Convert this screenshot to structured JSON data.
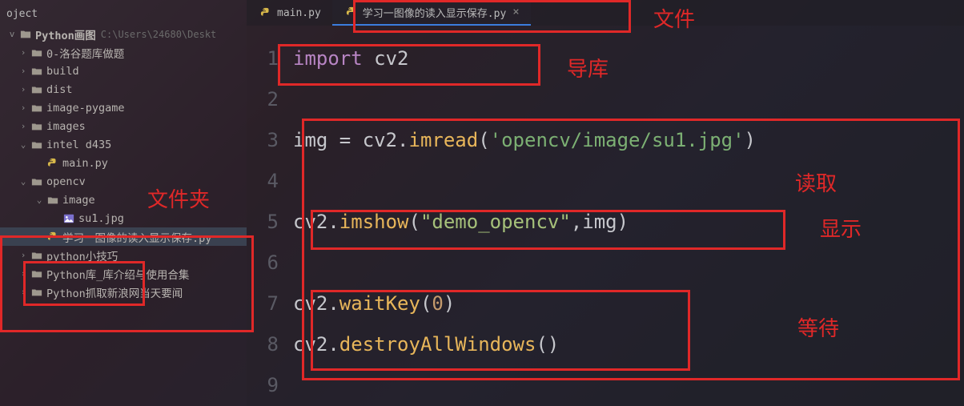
{
  "project": {
    "header": "oject",
    "rootName": "Python画图",
    "rootPath": "C:\\Users\\24680\\Deskt"
  },
  "tree": [
    {
      "name": "0-洛谷题库做题",
      "type": "folder",
      "ind": "indent1",
      "chev": ">"
    },
    {
      "name": "build",
      "type": "folder",
      "ind": "indent1",
      "chev": ">"
    },
    {
      "name": "dist",
      "type": "folder",
      "ind": "indent1",
      "chev": ">"
    },
    {
      "name": "image-pygame",
      "type": "folder",
      "ind": "indent1",
      "chev": ">"
    },
    {
      "name": "images",
      "type": "folder",
      "ind": "indent1",
      "chev": ">"
    },
    {
      "name": "intel d435",
      "type": "folder",
      "ind": "indent1",
      "chev": "v"
    },
    {
      "name": "main.py",
      "type": "py",
      "ind": "indent2",
      "chev": ""
    },
    {
      "name": "opencv",
      "type": "folder",
      "ind": "indent1",
      "chev": "v"
    },
    {
      "name": "image",
      "type": "folder",
      "ind": "indent2",
      "chev": "v"
    },
    {
      "name": "su1.jpg",
      "type": "img",
      "ind": "indent3",
      "chev": ""
    },
    {
      "name": "学习一图像的读入显示保存.py",
      "type": "py",
      "ind": "indent2",
      "chev": "",
      "sel": true
    },
    {
      "name": "python小技巧",
      "type": "folder",
      "ind": "indent1",
      "chev": ">"
    },
    {
      "name": "Python库_库介绍与使用合集",
      "type": "folder",
      "ind": "indent1",
      "chev": ">"
    },
    {
      "name": "Python抓取新浪网当天要闻",
      "type": "folder",
      "ind": "indent1",
      "chev": ">"
    }
  ],
  "tabs": [
    {
      "name": "main.py",
      "active": false
    },
    {
      "name": "学习一图像的读入显示保存.py",
      "active": true,
      "close": "×"
    }
  ],
  "gutter": [
    "1",
    "2",
    "3",
    "4",
    "5",
    "6",
    "7",
    "8",
    "9"
  ],
  "code": {
    "l1_kw": "import",
    "l1_id": " cv2",
    "l3_a": "img ",
    "l3_op": "= ",
    "l3_b": "cv2.",
    "l3_fn": "imread",
    "l3_p1": "(",
    "l3_s": "'opencv/image/su1.jpg'",
    "l3_p2": ")",
    "l5_a": "cv2.",
    "l5_fn": "imshow",
    "l5_p1": "(",
    "l5_s": "\"demo_opencv\"",
    "l5_c": ",img)",
    "l7_a": "cv2.",
    "l7_fn": "waitKey",
    "l7_p1": "(",
    "l7_n": "0",
    "l7_p2": ")",
    "l8_a": "cv2.",
    "l8_fn": "destroyAllWindows",
    "l8_p": "()"
  },
  "annotations": {
    "file": "文件",
    "folder": "文件夹",
    "import_lib": "导库",
    "read": "读取",
    "show": "显示",
    "wait": "等待"
  }
}
